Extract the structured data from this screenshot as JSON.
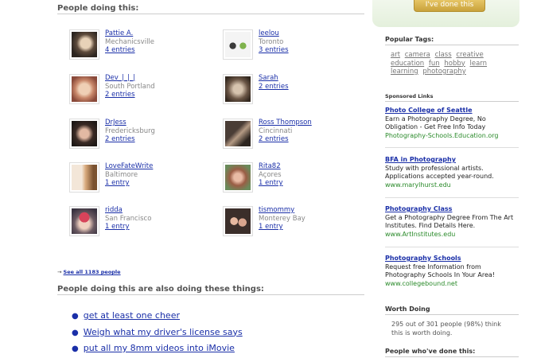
{
  "top": {
    "done_button": "I've done this"
  },
  "people_section": {
    "title": "People doing this:"
  },
  "people": [
    {
      "name": "Pattie A.",
      "location": "Mechanicsville",
      "entries": "4 entries"
    },
    {
      "name": "leelou",
      "location": "Toronto",
      "entries": "3 entries"
    },
    {
      "name": "Dev_|_|_|",
      "location": "South Portland",
      "entries": "2 entries"
    },
    {
      "name": "Sarah",
      "location": "",
      "entries": "2 entries"
    },
    {
      "name": "DrJess",
      "location": "Fredericksburg",
      "entries": "2 entries"
    },
    {
      "name": "Ross Thompson",
      "location": "Cincinnati",
      "entries": "2 entries"
    },
    {
      "name": "LoveFateWrite",
      "location": "Baltimore",
      "entries": "1 entry"
    },
    {
      "name": "Rita82",
      "location": "Açores",
      "entries": "1 entry"
    },
    {
      "name": "ridda",
      "location": "San Francisco",
      "entries": "1 entry"
    },
    {
      "name": "tismommy",
      "location": "Monterey Bay",
      "entries": "1 entry"
    }
  ],
  "see_all": {
    "arrow": "→",
    "label": "See all 1183 people"
  },
  "also_section": {
    "title": "People doing this are also doing these things:"
  },
  "also_items": [
    "get at least one cheer",
    "Weigh what my driver's license says",
    "put all my 8mm videos into iMovie"
  ],
  "sidebar": {
    "popular_tags_title": "Popular Tags:",
    "tags": [
      "art",
      "camera",
      "class",
      "creative",
      "education",
      "fun",
      "hobby",
      "learn",
      "learning",
      "photography"
    ],
    "sponsored_title": "Sponsored Links",
    "ads": [
      {
        "title": "Photo College of Seattle",
        "body": "Earn a Photography Degree, No Obligation - Get Free Info Today",
        "url": "Photography-Schools.Education.org"
      },
      {
        "title": "BFA in Photography",
        "body": "Study with professional artists. Applications accepted year-round.",
        "url": "www.marylhurst.edu"
      },
      {
        "title": "Photography Class",
        "body": "Get a Photography Degree From The Art Institutes. Find Details Here.",
        "url": "www.ArtInstitutes.edu"
      },
      {
        "title": "Photography Schools",
        "body": "Request free Information from Photography Schools In Your Area!",
        "url": "www.collegebound.net"
      }
    ],
    "worth_title": "Worth Doing",
    "worth_text": "295 out of 301 people (98%) think this is worth doing.",
    "done_title": "People who've done this:"
  }
}
